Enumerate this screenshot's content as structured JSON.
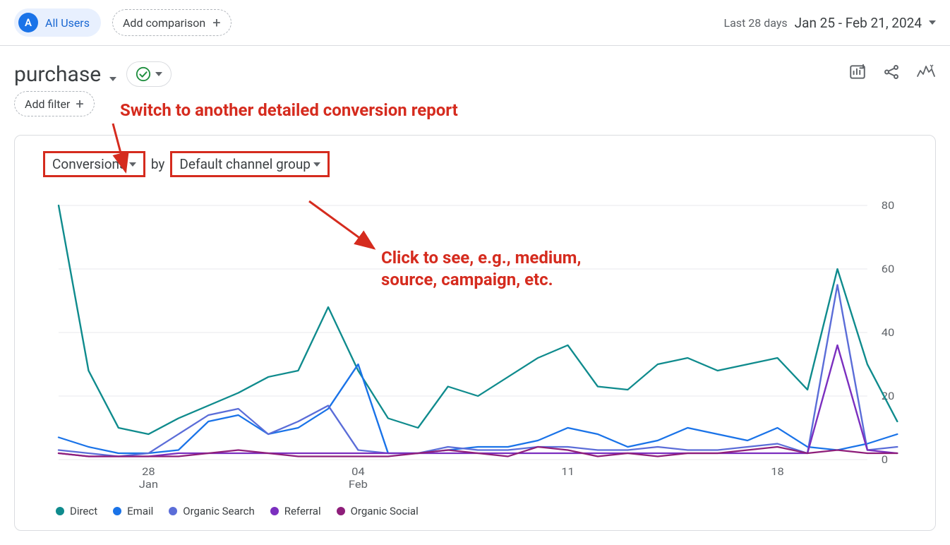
{
  "topbar": {
    "segment_letter": "A",
    "segment_label": "All Users",
    "add_comparison": "Add comparison"
  },
  "date_picker": {
    "label": "Last 28 days",
    "range": "Jan 25 - Feb 21, 2024"
  },
  "report": {
    "title": "purchase",
    "add_filter": "Add filter"
  },
  "dimensions": {
    "metric": "Conversions",
    "by": "by",
    "dim": "Default channel group"
  },
  "annotations": {
    "a1": "Switch to another detailed conversion report",
    "a2_line1": "Click to see, e.g., medium,",
    "a2_line2": "source, campaign, etc."
  },
  "chart_data": {
    "type": "line",
    "title": "Conversions by Default channel group",
    "xlabel": "",
    "ylabel": "",
    "ylim": [
      0,
      80
    ],
    "yticks": [
      0,
      20,
      40,
      60,
      80
    ],
    "x_dates_major": [
      "28\nJan",
      "04\nFeb",
      "11",
      "18"
    ],
    "x": [
      "Jan 25",
      "Jan 26",
      "Jan 27",
      "Jan 28",
      "Jan 29",
      "Jan 30",
      "Jan 31",
      "Feb 01",
      "Feb 02",
      "Feb 03",
      "Feb 04",
      "Feb 05",
      "Feb 06",
      "Feb 07",
      "Feb 08",
      "Feb 09",
      "Feb 10",
      "Feb 11",
      "Feb 12",
      "Feb 13",
      "Feb 14",
      "Feb 15",
      "Feb 16",
      "Feb 17",
      "Feb 18",
      "Feb 19",
      "Feb 20",
      "Feb 21"
    ],
    "series": [
      {
        "name": "Direct",
        "color": "#0f8b8d",
        "values": [
          80,
          28,
          10,
          8,
          13,
          17,
          21,
          26,
          28,
          48,
          28,
          13,
          10,
          23,
          20,
          26,
          32,
          36,
          23,
          22,
          30,
          32,
          28,
          30,
          32,
          22,
          60,
          30,
          12
        ]
      },
      {
        "name": "Email",
        "color": "#1a73e8",
        "values": [
          7,
          4,
          2,
          2,
          3,
          12,
          14,
          8,
          10,
          16,
          30,
          2,
          2,
          3,
          4,
          4,
          6,
          10,
          8,
          4,
          6,
          10,
          8,
          6,
          10,
          4,
          3,
          5,
          8
        ]
      },
      {
        "name": "Organic Search",
        "color": "#5b6dd8",
        "values": [
          3,
          2,
          1,
          2,
          8,
          14,
          16,
          8,
          12,
          17,
          3,
          2,
          2,
          4,
          3,
          3,
          4,
          4,
          3,
          3,
          4,
          3,
          3,
          4,
          5,
          2,
          55,
          3,
          4
        ]
      },
      {
        "name": "Referral",
        "color": "#7b2fbf",
        "values": [
          2,
          1,
          1,
          1,
          2,
          2,
          2,
          2,
          2,
          2,
          2,
          2,
          2,
          2,
          2,
          2,
          2,
          2,
          2,
          2,
          2,
          2,
          2,
          2,
          2,
          2,
          36,
          3,
          2
        ]
      },
      {
        "name": "Organic Social",
        "color": "#8e1e7a",
        "values": [
          2,
          1,
          1,
          1,
          1,
          2,
          3,
          2,
          1,
          1,
          1,
          1,
          2,
          3,
          2,
          1,
          4,
          3,
          1,
          2,
          1,
          2,
          2,
          3,
          4,
          2,
          3,
          2,
          2
        ]
      }
    ],
    "legend_position": "bottom",
    "grid": true
  }
}
